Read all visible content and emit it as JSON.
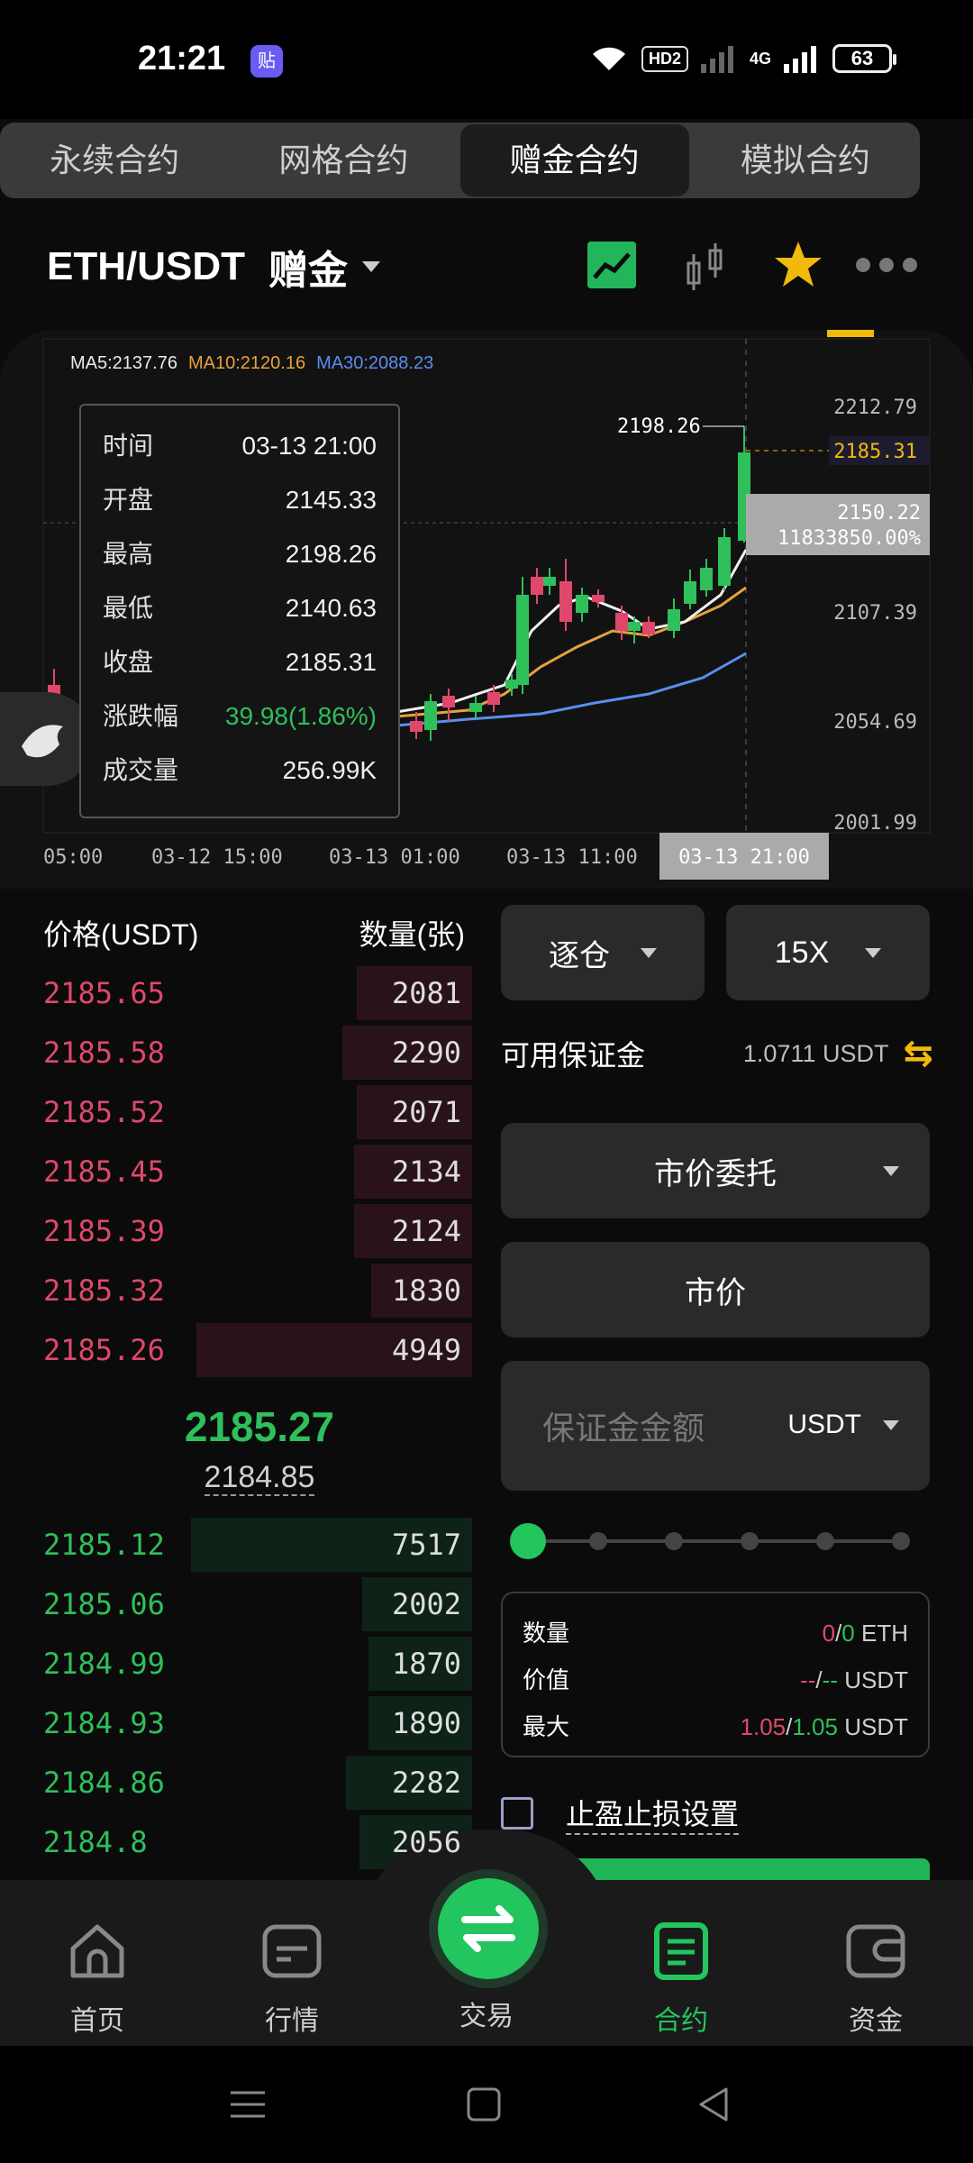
{
  "status_bar": {
    "time": "21:21",
    "app_badge": "贴",
    "hd": "HD2",
    "net": "4G",
    "battery": "63"
  },
  "tabs": [
    {
      "label": "永续合约",
      "active": false
    },
    {
      "label": "网格合约",
      "active": false
    },
    {
      "label": "赠金合约",
      "active": true
    },
    {
      "label": "模拟合约",
      "active": false
    }
  ],
  "pair": {
    "name": "ETH/USDT",
    "tag": "赠金"
  },
  "chart": {
    "ma5": "MA5:2137.76",
    "ma10": "MA10:2120.16",
    "ma30": "MA30:2088.23",
    "price_ticks": [
      "2212.79",
      "2107.39",
      "2054.69",
      "2001.99"
    ],
    "current_price_tag": "2185.31",
    "high_marker": "2198.26",
    "crosshair_price": "2150.22",
    "crosshair_pct": "11833850.00%",
    "time_ticks": [
      "05:00",
      "03-12 15:00",
      "03-13 01:00",
      "03-13 11:00"
    ],
    "crosshair_time": "03-13 21:00",
    "tooltip": [
      {
        "label": "时间",
        "value": "03-13 21:00"
      },
      {
        "label": "开盘",
        "value": "2145.33"
      },
      {
        "label": "最高",
        "value": "2198.26"
      },
      {
        "label": "最低",
        "value": "2140.63"
      },
      {
        "label": "收盘",
        "value": "2185.31"
      },
      {
        "label": "涨跌幅",
        "value": "39.98(1.86%)"
      },
      {
        "label": "成交量",
        "value": "256.99K"
      }
    ]
  },
  "orderbook": {
    "price_header": "价格(USDT)",
    "qty_header": "数量(张)",
    "asks": [
      {
        "price": "2185.65",
        "qty": "2081",
        "depth": 0.41
      },
      {
        "price": "2185.58",
        "qty": "2290",
        "depth": 0.46
      },
      {
        "price": "2185.52",
        "qty": "2071",
        "depth": 0.41
      },
      {
        "price": "2185.45",
        "qty": "2134",
        "depth": 0.42
      },
      {
        "price": "2185.39",
        "qty": "2124",
        "depth": 0.42
      },
      {
        "price": "2185.32",
        "qty": "1830",
        "depth": 0.36
      },
      {
        "price": "2185.26",
        "qty": "4949",
        "depth": 0.98
      }
    ],
    "last_price": "2185.27",
    "mark_price": "2184.85",
    "bids": [
      {
        "price": "2185.12",
        "qty": "7517",
        "depth": 1.0
      },
      {
        "price": "2185.06",
        "qty": "2002",
        "depth": 0.39
      },
      {
        "price": "2184.99",
        "qty": "1870",
        "depth": 0.37
      },
      {
        "price": "2184.93",
        "qty": "1890",
        "depth": 0.37
      },
      {
        "price": "2184.86",
        "qty": "2282",
        "depth": 0.45
      },
      {
        "price": "2184.8",
        "qty": "2056",
        "depth": 0.4
      }
    ]
  },
  "trade": {
    "margin_mode": "逐仓",
    "leverage": "15X",
    "available_label": "可用保证金",
    "available_value": "1.0711 USDT",
    "order_type": "市价委托",
    "price_type": "市价",
    "amount_placeholder": "保证金金额",
    "amount_unit": "USDT",
    "slider_level": 0,
    "info": {
      "qty_label": "数量",
      "qty_a": "0",
      "qty_b": "0",
      "qty_unit": "ETH",
      "value_label": "价值",
      "value_a": "--",
      "value_b": "--",
      "value_unit": "USDT",
      "max_label": "最大",
      "max_a": "1.05",
      "max_b": "1.05",
      "max_unit": "USDT"
    },
    "tpsl_label": "止盈止损设置"
  },
  "bottom_nav": [
    {
      "label": "首页",
      "icon": "home-icon"
    },
    {
      "label": "行情",
      "icon": "market-icon"
    },
    {
      "label": "交易",
      "icon": "swap-arrows-icon"
    },
    {
      "label": "合约",
      "icon": "contract-icon",
      "active": true
    },
    {
      "label": "资金",
      "icon": "wallet-icon"
    }
  ],
  "colors": {
    "up": "#2fbf5b",
    "down": "#e0486b",
    "accent": "#22c55e",
    "gold": "#f0b90b"
  }
}
